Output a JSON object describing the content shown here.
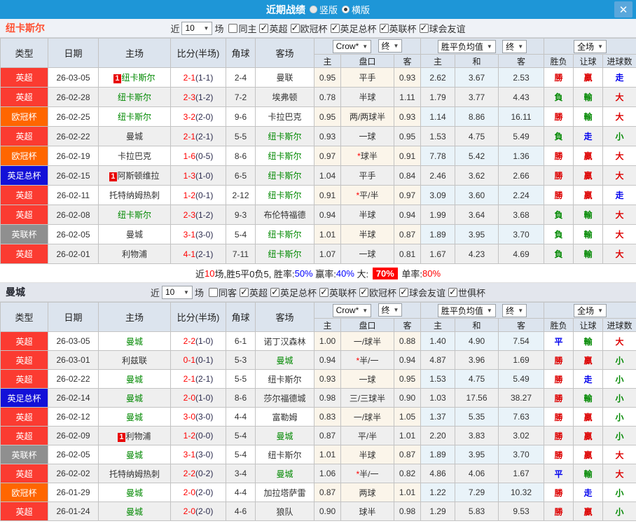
{
  "palette": {
    "titlebar_bg": "#1E96D7",
    "close_bg": "#5AA7DC",
    "league_red": "#FB3B31",
    "league_orange": "#FF6600",
    "league_blue": "#1310D8",
    "league_gray": "#8F8F8F",
    "self_team_green": "#008800",
    "score_red": "#FF0000",
    "result_red": "#DD0000",
    "result_green": "#008800",
    "result_blue": "#0000EE",
    "header_bg": "#DCE4EE",
    "row_alt": "#EFEFEF",
    "handicap_tint": "#FBF5EA",
    "wdw_tint": "#E9F3F9",
    "team1_color": "#FF5031",
    "team2_color": "#22252e"
  },
  "titlebar": {
    "title": "近期战绩",
    "radio_vertical": "竖版",
    "radio_horizontal": "横版",
    "selected": "横版",
    "close": "✕"
  },
  "headers": {
    "cols": [
      "类型",
      "日期",
      "主场",
      "比分(半场)",
      "角球",
      "客场"
    ],
    "subs": [
      "主",
      "盘口",
      "客",
      "主",
      "和",
      "客",
      "胜负",
      "让球",
      "进球数"
    ],
    "dd_company": "Crow*",
    "dd_final": "终",
    "dd_avg": "胜平负均值",
    "dd_scope": "全场"
  },
  "sections": [
    {
      "team": "纽卡斯尔",
      "near_label": "近",
      "games_count": "10",
      "games_label": "场",
      "filters": [
        {
          "label": "同主",
          "state": "off"
        },
        {
          "label": "英超",
          "state": "on"
        },
        {
          "label": "欧冠杯",
          "state": "on"
        },
        {
          "label": "英足总杯",
          "state": "on"
        },
        {
          "label": "英联杯",
          "state": "on"
        },
        {
          "label": "球会友谊",
          "state": "on"
        }
      ],
      "rows": [
        {
          "lg": "英超",
          "lgc": "lg-red",
          "date": "26-03-05",
          "hb": "1",
          "home": "纽卡斯尔",
          "hc": "self",
          "score": "2-1",
          "half": "(1-1)",
          "corner": "2-4",
          "away": "曼联",
          "ac": "",
          "h1": "0.95",
          "hstar": "",
          "hcap": "平手",
          "a1": "0.93",
          "w": "2.62",
          "d": "3.67",
          "l": "2.53",
          "r1": "勝",
          "r1c": "rr",
          "r2": "贏",
          "r2c": "rr",
          "r3": "走",
          "r3c": "rb"
        },
        {
          "lg": "英超",
          "lgc": "lg-red",
          "date": "26-02-28",
          "hb": "",
          "home": "纽卡斯尔",
          "hc": "self",
          "score": "2-3",
          "half": "(1-2)",
          "corner": "7-2",
          "away": "埃弗顿",
          "ac": "",
          "h1": "0.78",
          "hstar": "",
          "hcap": "半球",
          "a1": "1.11",
          "w": "1.79",
          "d": "3.77",
          "l": "4.43",
          "r1": "負",
          "r1c": "rg",
          "r2": "輸",
          "r2c": "rg",
          "r3": "大",
          "r3c": "rr"
        },
        {
          "lg": "欧冠杯",
          "lgc": "lg-orange",
          "date": "26-02-25",
          "hb": "",
          "home": "纽卡斯尔",
          "hc": "self",
          "score": "3-2",
          "half": "(2-0)",
          "corner": "9-6",
          "away": "卡拉巴克",
          "ac": "",
          "h1": "0.95",
          "hstar": "",
          "hcap": "两/两球半",
          "a1": "0.93",
          "w": "1.14",
          "d": "8.86",
          "l": "16.11",
          "r1": "勝",
          "r1c": "rr",
          "r2": "輸",
          "r2c": "rg",
          "r3": "大",
          "r3c": "rr"
        },
        {
          "lg": "英超",
          "lgc": "lg-red",
          "date": "26-02-22",
          "hb": "",
          "home": "曼城",
          "hc": "",
          "score": "2-1",
          "half": "(2-1)",
          "corner": "5-5",
          "away": "纽卡斯尔",
          "ac": "self",
          "h1": "0.93",
          "hstar": "",
          "hcap": "一球",
          "a1": "0.95",
          "w": "1.53",
          "d": "4.75",
          "l": "5.49",
          "r1": "負",
          "r1c": "rg",
          "r2": "走",
          "r2c": "rb",
          "r3": "小",
          "r3c": "rg"
        },
        {
          "lg": "欧冠杯",
          "lgc": "lg-orange",
          "date": "26-02-19",
          "hb": "",
          "home": "卡拉巴克",
          "hc": "",
          "score": "1-6",
          "half": "(0-5)",
          "corner": "8-6",
          "away": "纽卡斯尔",
          "ac": "self",
          "h1": "0.97",
          "hstar": "*",
          "hcap": "球半",
          "a1": "0.91",
          "w": "7.78",
          "d": "5.42",
          "l": "1.36",
          "r1": "勝",
          "r1c": "rr",
          "r2": "贏",
          "r2c": "rr",
          "r3": "大",
          "r3c": "rr"
        },
        {
          "lg": "英足总杯",
          "lgc": "lg-blue",
          "date": "26-02-15",
          "hb": "1",
          "home": "阿斯顿维拉",
          "hc": "",
          "score": "1-3",
          "half": "(1-0)",
          "corner": "6-5",
          "away": "纽卡斯尔",
          "ac": "self",
          "h1": "1.04",
          "hstar": "",
          "hcap": "平手",
          "a1": "0.84",
          "w": "2.46",
          "d": "3.62",
          "l": "2.66",
          "r1": "勝",
          "r1c": "rr",
          "r2": "贏",
          "r2c": "rr",
          "r3": "大",
          "r3c": "rr"
        },
        {
          "lg": "英超",
          "lgc": "lg-red",
          "date": "26-02-11",
          "hb": "",
          "home": "托特纳姆热刺",
          "hc": "",
          "score": "1-2",
          "half": "(0-1)",
          "corner": "2-12",
          "away": "纽卡斯尔",
          "ac": "self",
          "h1": "0.91",
          "hstar": "*",
          "hcap": "平/半",
          "a1": "0.97",
          "w": "3.09",
          "d": "3.60",
          "l": "2.24",
          "r1": "勝",
          "r1c": "rr",
          "r2": "贏",
          "r2c": "rr",
          "r3": "走",
          "r3c": "rb"
        },
        {
          "lg": "英超",
          "lgc": "lg-red",
          "date": "26-02-08",
          "hb": "",
          "home": "纽卡斯尔",
          "hc": "self",
          "score": "2-3",
          "half": "(1-2)",
          "corner": "9-3",
          "away": "布伦特福德",
          "ac": "",
          "h1": "0.94",
          "hstar": "",
          "hcap": "半球",
          "a1": "0.94",
          "w": "1.99",
          "d": "3.64",
          "l": "3.68",
          "r1": "負",
          "r1c": "rg",
          "r2": "輸",
          "r2c": "rg",
          "r3": "大",
          "r3c": "rr"
        },
        {
          "lg": "英联杯",
          "lgc": "lg-gray",
          "date": "26-02-05",
          "hb": "",
          "home": "曼城",
          "hc": "",
          "score": "3-1",
          "half": "(3-0)",
          "corner": "5-4",
          "away": "纽卡斯尔",
          "ac": "self",
          "h1": "1.01",
          "hstar": "",
          "hcap": "半球",
          "a1": "0.87",
          "w": "1.89",
          "d": "3.95",
          "l": "3.70",
          "r1": "負",
          "r1c": "rg",
          "r2": "輸",
          "r2c": "rg",
          "r3": "大",
          "r3c": "rr"
        },
        {
          "lg": "英超",
          "lgc": "lg-red",
          "date": "26-02-01",
          "hb": "",
          "home": "利物浦",
          "hc": "",
          "score": "4-1",
          "half": "(2-1)",
          "corner": "7-11",
          "away": "纽卡斯尔",
          "ac": "self",
          "h1": "1.07",
          "hstar": "",
          "hcap": "一球",
          "a1": "0.81",
          "w": "1.67",
          "d": "4.23",
          "l": "4.69",
          "r1": "負",
          "r1c": "rg",
          "r2": "輸",
          "r2c": "rg",
          "r3": "大",
          "r3c": "rr"
        }
      ],
      "summary": [
        {
          "text": "近",
          "cls": ""
        },
        {
          "text": "10",
          "cls": "s-red"
        },
        {
          "text": "场,胜5平0负5, 胜率:",
          "cls": ""
        },
        {
          "text": "50%",
          "cls": "s-blue"
        },
        {
          "text": " 赢率:",
          "cls": ""
        },
        {
          "text": "40%",
          "cls": "s-blue"
        },
        {
          "text": " 大: ",
          "cls": ""
        },
        {
          "text": "70%",
          "cls": "s-badge"
        },
        {
          "text": " 单率:",
          "cls": ""
        },
        {
          "text": "80%",
          "cls": "s-red"
        }
      ]
    },
    {
      "team": "曼城",
      "near_label": "近",
      "games_count": "10",
      "games_label": "场",
      "filters": [
        {
          "label": "同客",
          "state": "off"
        },
        {
          "label": "英超",
          "state": "on"
        },
        {
          "label": "英足总杯",
          "state": "on"
        },
        {
          "label": "英联杯",
          "state": "on"
        },
        {
          "label": "欧冠杯",
          "state": "on"
        },
        {
          "label": "球会友谊",
          "state": "on"
        },
        {
          "label": "世俱杯",
          "state": "on"
        }
      ],
      "rows": [
        {
          "lg": "英超",
          "lgc": "lg-red",
          "date": "26-03-05",
          "hb": "",
          "home": "曼城",
          "hc": "self",
          "score": "2-2",
          "half": "(1-0)",
          "corner": "6-1",
          "away": "诺丁汉森林",
          "ac": "",
          "h1": "1.00",
          "hstar": "",
          "hcap": "一/球半",
          "a1": "0.88",
          "w": "1.40",
          "d": "4.90",
          "l": "7.54",
          "r1": "平",
          "r1c": "rb",
          "r2": "輸",
          "r2c": "rg",
          "r3": "大",
          "r3c": "rr"
        },
        {
          "lg": "英超",
          "lgc": "lg-red",
          "date": "26-03-01",
          "hb": "",
          "home": "利兹联",
          "hc": "",
          "score": "0-1",
          "half": "(0-1)",
          "corner": "5-3",
          "away": "曼城",
          "ac": "self",
          "h1": "0.94",
          "hstar": "*",
          "hcap": "半/一",
          "a1": "0.94",
          "w": "4.87",
          "d": "3.96",
          "l": "1.69",
          "r1": "勝",
          "r1c": "rr",
          "r2": "贏",
          "r2c": "rr",
          "r3": "小",
          "r3c": "rg"
        },
        {
          "lg": "英超",
          "lgc": "lg-red",
          "date": "26-02-22",
          "hb": "",
          "home": "曼城",
          "hc": "self",
          "score": "2-1",
          "half": "(2-1)",
          "corner": "5-5",
          "away": "纽卡斯尔",
          "ac": "",
          "h1": "0.93",
          "hstar": "",
          "hcap": "一球",
          "a1": "0.95",
          "w": "1.53",
          "d": "4.75",
          "l": "5.49",
          "r1": "勝",
          "r1c": "rr",
          "r2": "走",
          "r2c": "rb",
          "r3": "小",
          "r3c": "rg"
        },
        {
          "lg": "英足总杯",
          "lgc": "lg-blue",
          "date": "26-02-14",
          "hb": "",
          "home": "曼城",
          "hc": "self",
          "score": "2-0",
          "half": "(1-0)",
          "corner": "8-6",
          "away": "莎尔福德城",
          "ac": "",
          "h1": "0.98",
          "hstar": "",
          "hcap": "三/三球半",
          "a1": "0.90",
          "w": "1.03",
          "d": "17.56",
          "l": "38.27",
          "r1": "勝",
          "r1c": "rr",
          "r2": "輸",
          "r2c": "rg",
          "r3": "小",
          "r3c": "rg"
        },
        {
          "lg": "英超",
          "lgc": "lg-red",
          "date": "26-02-12",
          "hb": "",
          "home": "曼城",
          "hc": "self",
          "score": "3-0",
          "half": "(3-0)",
          "corner": "4-4",
          "away": "富勒姆",
          "ac": "",
          "h1": "0.83",
          "hstar": "",
          "hcap": "一/球半",
          "a1": "1.05",
          "w": "1.37",
          "d": "5.35",
          "l": "7.63",
          "r1": "勝",
          "r1c": "rr",
          "r2": "贏",
          "r2c": "rr",
          "r3": "小",
          "r3c": "rg"
        },
        {
          "lg": "英超",
          "lgc": "lg-red",
          "date": "26-02-09",
          "hb": "1",
          "home": "利物浦",
          "hc": "",
          "score": "1-2",
          "half": "(0-0)",
          "corner": "5-4",
          "away": "曼城",
          "ac": "self",
          "h1": "0.87",
          "hstar": "",
          "hcap": "平/半",
          "a1": "1.01",
          "w": "2.20",
          "d": "3.83",
          "l": "3.02",
          "r1": "勝",
          "r1c": "rr",
          "r2": "贏",
          "r2c": "rr",
          "r3": "小",
          "r3c": "rg"
        },
        {
          "lg": "英联杯",
          "lgc": "lg-gray",
          "date": "26-02-05",
          "hb": "",
          "home": "曼城",
          "hc": "self",
          "score": "3-1",
          "half": "(3-0)",
          "corner": "5-4",
          "away": "纽卡斯尔",
          "ac": "",
          "h1": "1.01",
          "hstar": "",
          "hcap": "半球",
          "a1": "0.87",
          "w": "1.89",
          "d": "3.95",
          "l": "3.70",
          "r1": "勝",
          "r1c": "rr",
          "r2": "贏",
          "r2c": "rr",
          "r3": "大",
          "r3c": "rr"
        },
        {
          "lg": "英超",
          "lgc": "lg-red",
          "date": "26-02-02",
          "hb": "",
          "home": "托特纳姆热刺",
          "hc": "",
          "score": "2-2",
          "half": "(0-2)",
          "corner": "3-4",
          "away": "曼城",
          "ac": "self",
          "h1": "1.06",
          "hstar": "*",
          "hcap": "半/一",
          "a1": "0.82",
          "w": "4.86",
          "d": "4.06",
          "l": "1.67",
          "r1": "平",
          "r1c": "rb",
          "r2": "輸",
          "r2c": "rg",
          "r3": "大",
          "r3c": "rr"
        },
        {
          "lg": "欧冠杯",
          "lgc": "lg-orange",
          "date": "26-01-29",
          "hb": "",
          "home": "曼城",
          "hc": "self",
          "score": "2-0",
          "half": "(2-0)",
          "corner": "4-4",
          "away": "加拉塔萨雷",
          "ac": "",
          "h1": "0.87",
          "hstar": "",
          "hcap": "两球",
          "a1": "1.01",
          "w": "1.22",
          "d": "7.29",
          "l": "10.32",
          "r1": "勝",
          "r1c": "rr",
          "r2": "走",
          "r2c": "rb",
          "r3": "小",
          "r3c": "rg"
        },
        {
          "lg": "英超",
          "lgc": "lg-red",
          "date": "26-01-24",
          "hb": "",
          "home": "曼城",
          "hc": "self",
          "score": "2-0",
          "half": "(2-0)",
          "corner": "4-6",
          "away": "狼队",
          "ac": "",
          "h1": "0.90",
          "hstar": "",
          "hcap": "球半",
          "a1": "0.98",
          "w": "1.29",
          "d": "5.83",
          "l": "9.53",
          "r1": "勝",
          "r1c": "rr",
          "r2": "贏",
          "r2c": "rr",
          "r3": "小",
          "r3c": "rg"
        }
      ]
    }
  ]
}
